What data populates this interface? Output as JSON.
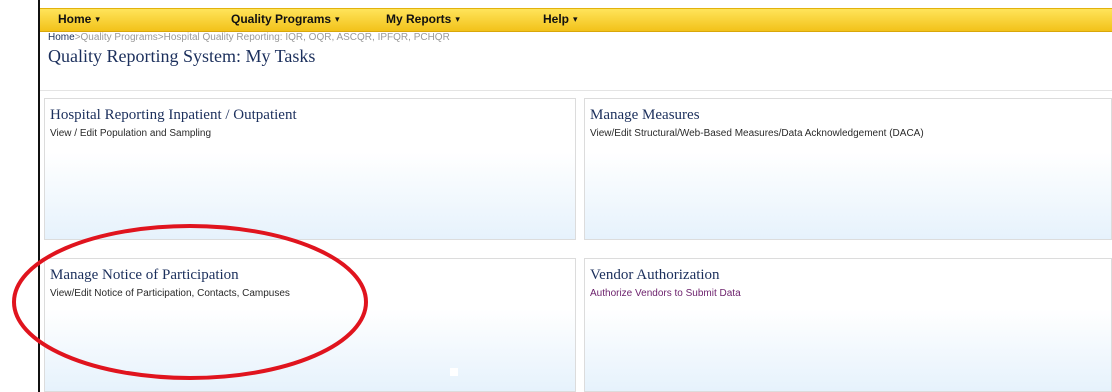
{
  "nav": {
    "items": [
      {
        "label": "Home"
      },
      {
        "label": "Quality Programs"
      },
      {
        "label": "My Reports"
      },
      {
        "label": "Help"
      }
    ],
    "caret": "▾"
  },
  "breadcrumb": {
    "home": "Home",
    "sep1": ">",
    "quality_programs": "Quality Programs",
    "sep2": ">",
    "current": "Hospital Quality Reporting: IQR, OQR, ASCQR, IPFQR, PCHQR"
  },
  "page": {
    "title": "Quality Reporting System: My Tasks"
  },
  "panels": [
    {
      "title": "Hospital Reporting Inpatient / Outpatient",
      "link": "View / Edit Population and Sampling"
    },
    {
      "title": "Manage Measures",
      "link": "View/Edit Structural/Web-Based Measures/Data Acknowledgement (DACA)"
    },
    {
      "title": "Manage Notice of Participation",
      "link": "View/Edit Notice of Participation, Contacts, Campuses"
    },
    {
      "title": "Vendor Authorization",
      "link": "Authorize Vendors to Submit Data"
    }
  ],
  "colors": {
    "nav_bar": "#f5c928",
    "title_text": "#1b2f5c",
    "annotation_ellipse": "#e0141e",
    "vendor_link": "#6b1f6b"
  }
}
